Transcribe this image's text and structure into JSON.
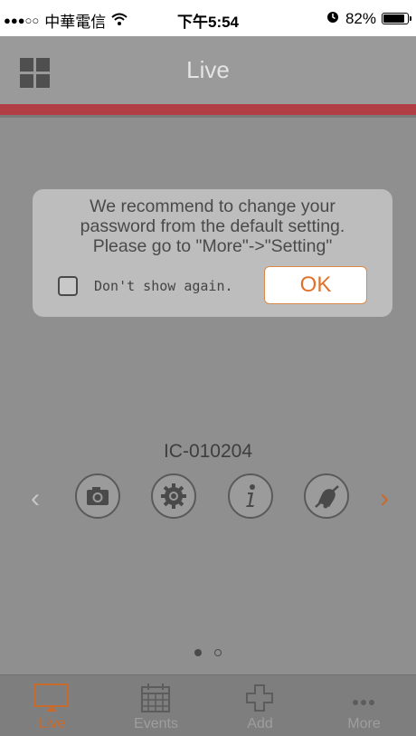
{
  "status_bar": {
    "signal": "●●●○○",
    "carrier": "中華電信",
    "time": "下午5:54",
    "battery_text": "82%",
    "battery_level": 0.82
  },
  "nav": {
    "title": "Live"
  },
  "dialog": {
    "message_lines": [
      "We recommend to change your",
      "password from the default setting.",
      "Please go to \"More\"->\"Setting\""
    ],
    "checkbox_label": "Don't show again.",
    "checkbox_checked": false,
    "ok_label": "OK"
  },
  "camera": {
    "name": "IC-010204",
    "prev_arrow": "‹",
    "next_arrow": "›",
    "controls": [
      "camera-icon",
      "gear-icon",
      "info-icon",
      "alarm-off-icon"
    ]
  },
  "pager": {
    "current": 1,
    "total": 2
  },
  "tabs": [
    {
      "label": "Live",
      "icon": "monitor-icon",
      "active": true
    },
    {
      "label": "Events",
      "icon": "calendar-icon",
      "active": false
    },
    {
      "label": "Add",
      "icon": "plus-icon",
      "active": false
    },
    {
      "label": "More",
      "icon": "more-icon",
      "active": false
    }
  ],
  "colors": {
    "accent": "#c96a2d",
    "header_stripe": "#b13d45",
    "overlay": "#8f8f8f"
  }
}
